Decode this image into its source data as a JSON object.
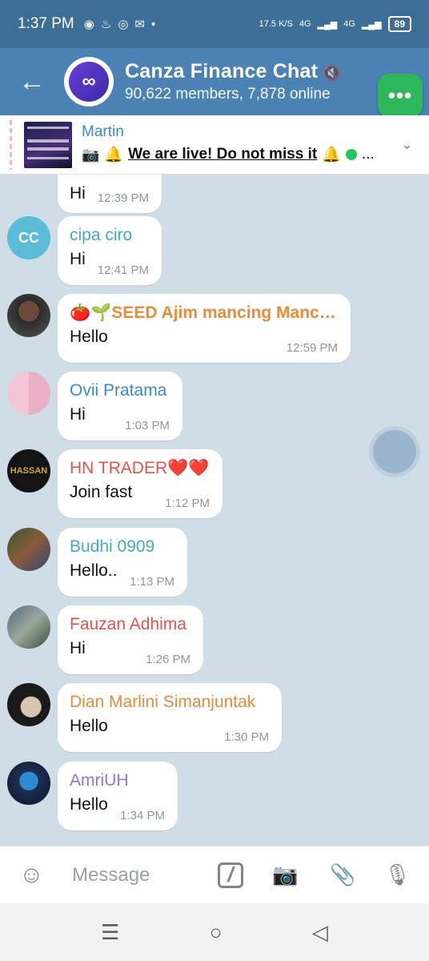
{
  "status_bar": {
    "time": "1:37 PM",
    "net_speed": "17.5 K/S",
    "net1": "4G",
    "net2": "4G",
    "battery": "89"
  },
  "header": {
    "back_icon": "arrow-left-icon",
    "title": "Canza Finance Chat",
    "subtitle": "90,622 members, 7,878 online"
  },
  "pinned": {
    "name": "Martin",
    "message": "We are live! Do not miss it"
  },
  "messages": [
    {
      "initials": "",
      "name": "",
      "text": "Hi",
      "time": "12:39 PM",
      "name_color": "#3e89c8"
    },
    {
      "initials": "CC",
      "name": "cipa ciro",
      "text": "Hi",
      "time": "12:41 PM",
      "name_color": "#45a9c9",
      "avatar_color": "#5bbcd8"
    },
    {
      "initials": "",
      "name": "🍅🌱SEED Ajim mancing Manci…",
      "text": "Hello",
      "time": "12:59 PM",
      "name_color": "#ea8a3c"
    },
    {
      "initials": "",
      "name": "Ovii Pratama",
      "text": "Hi",
      "time": "1:03 PM",
      "name_color": "#3e89c8"
    },
    {
      "initials": "",
      "name": "HN TRADER❤️❤️",
      "text": "Join fast",
      "time": "1:12 PM",
      "name_color": "#e3524d"
    },
    {
      "initials": "",
      "name": "Budhi 0909",
      "text": "Hello..",
      "time": "1:13 PM",
      "name_color": "#45a9c9"
    },
    {
      "initials": "",
      "name": "Fauzan Adhima",
      "text": "Hi",
      "time": "1:26 PM",
      "name_color": "#e3524d"
    },
    {
      "initials": "",
      "name": "Dian Marlini Simanjuntak",
      "text": "Hello",
      "time": "1:30 PM",
      "name_color": "#ea8a3c"
    },
    {
      "initials": "",
      "name": "AmriUH",
      "text": "Hello",
      "time": "1:34 PM",
      "name_color": "#9274d8"
    }
  ],
  "input": {
    "placeholder": "Message"
  }
}
